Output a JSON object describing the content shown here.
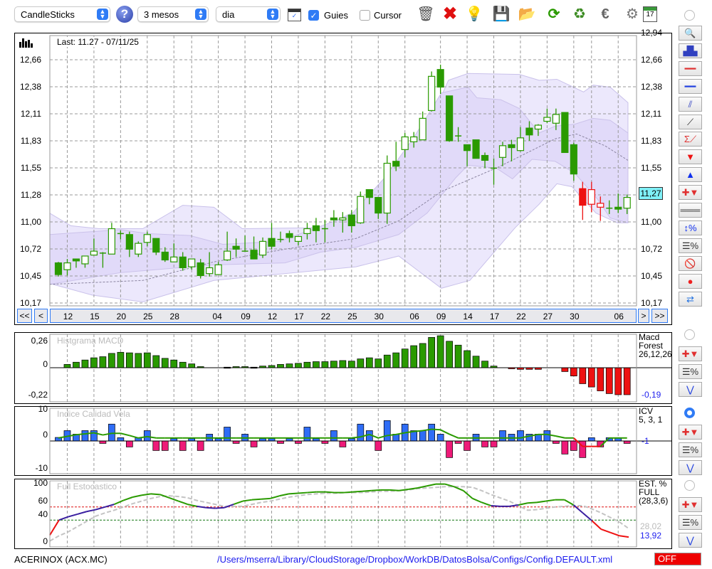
{
  "toolbar": {
    "chart_type": "CandleSticks",
    "period": "3 mesos",
    "interval": "dia",
    "guides_label": "Guies",
    "guides_checked": true,
    "cursor_label": "Cursor",
    "cursor_checked": false,
    "icons": [
      "help-icon",
      "chart-window-icon",
      "trash-icon",
      "delete-icon",
      "lamp-icon",
      "save-icon",
      "folder-icon",
      "refresh-icon",
      "recycle-icon",
      "euro-icon",
      "gear-icon",
      "calendar-icon"
    ],
    "calendar_day": "17"
  },
  "main": {
    "last_label": "Last: 11.27 - 07/11/25",
    "price_labels": [
      "12,94",
      "12,66",
      "12,38",
      "12,11",
      "11,83",
      "11,55",
      "11,28",
      "11,00",
      "10,72",
      "10,45",
      "10,17"
    ],
    "current_price": "11,27",
    "nav": {
      "first": "<<",
      "prev": "<",
      "next": ">",
      "last": ">>"
    },
    "date_labels": [
      {
        "t": "12",
        "i": 1
      },
      {
        "t": "15",
        "i": 4
      },
      {
        "t": "20",
        "i": 7
      },
      {
        "t": "25",
        "i": 10
      },
      {
        "t": "28",
        "i": 13
      },
      {
        "t": "04",
        "i": 17.8
      },
      {
        "t": "09",
        "i": 21
      },
      {
        "t": "12",
        "i": 24
      },
      {
        "t": "17",
        "i": 27
      },
      {
        "t": "22",
        "i": 30
      },
      {
        "t": "25",
        "i": 33
      },
      {
        "t": "30",
        "i": 36
      },
      {
        "t": "06",
        "i": 40
      },
      {
        "t": "09",
        "i": 43
      },
      {
        "t": "14",
        "i": 46
      },
      {
        "t": "17",
        "i": 49
      },
      {
        "t": "22",
        "i": 52
      },
      {
        "t": "27",
        "i": 55
      },
      {
        "t": "30",
        "i": 58
      },
      {
        "t": "06",
        "i": 63
      }
    ],
    "grid_index": [
      1,
      4,
      7,
      10,
      13,
      15,
      18,
      21,
      24,
      27,
      30,
      33,
      36,
      39,
      43,
      46,
      49,
      52,
      55,
      58,
      60,
      63
    ]
  },
  "chart_data": [
    {
      "type": "candlestick",
      "name": "ACERINOX price",
      "ylim": [
        10.17,
        12.94
      ],
      "up_color": "#ffffff",
      "down_color": "#2a9a00",
      "signal_color": "#ee1111",
      "candles": [
        [
          10.58,
          10.59,
          10.44,
          10.46
        ],
        [
          10.51,
          10.62,
          10.45,
          10.58
        ],
        [
          10.62,
          10.62,
          10.53,
          10.6
        ],
        [
          10.57,
          10.65,
          10.53,
          10.65
        ],
        [
          10.66,
          10.83,
          10.66,
          10.7
        ],
        [
          10.67,
          10.69,
          10.53,
          10.68
        ],
        [
          10.67,
          10.99,
          10.67,
          10.93
        ],
        [
          10.88,
          10.91,
          10.82,
          10.88
        ],
        [
          10.87,
          10.9,
          10.64,
          10.72
        ],
        [
          10.67,
          10.8,
          10.64,
          10.78
        ],
        [
          10.79,
          10.9,
          10.75,
          10.87
        ],
        [
          10.83,
          10.83,
          10.66,
          10.69
        ],
        [
          10.69,
          10.74,
          10.59,
          10.61
        ],
        [
          10.59,
          10.78,
          10.59,
          10.64
        ],
        [
          10.64,
          10.69,
          10.5,
          10.53
        ],
        [
          10.54,
          10.62,
          10.51,
          10.62
        ],
        [
          10.58,
          10.62,
          10.42,
          10.45
        ],
        [
          10.47,
          10.69,
          10.44,
          10.53
        ],
        [
          10.46,
          10.59,
          10.46,
          10.56
        ],
        [
          10.61,
          10.9,
          10.6,
          10.7
        ],
        [
          10.75,
          10.83,
          10.64,
          10.72
        ],
        [
          10.7,
          10.86,
          10.7,
          10.7
        ],
        [
          10.71,
          10.85,
          10.62,
          10.62
        ],
        [
          10.66,
          10.84,
          10.63,
          10.8
        ],
        [
          10.83,
          10.99,
          10.72,
          10.75
        ],
        [
          10.82,
          10.9,
          10.79,
          10.82
        ],
        [
          10.88,
          10.91,
          10.79,
          10.84
        ],
        [
          10.8,
          10.85,
          10.76,
          10.85
        ],
        [
          10.88,
          10.99,
          10.82,
          10.93
        ],
        [
          10.96,
          11.04,
          10.79,
          10.91
        ],
        [
          10.93,
          11.02,
          10.79,
          10.92
        ],
        [
          11.04,
          11.12,
          10.95,
          11.02
        ],
        [
          11.02,
          11.1,
          10.89,
          11.04
        ],
        [
          11.07,
          11.12,
          10.89,
          10.96
        ],
        [
          10.99,
          11.31,
          10.98,
          11.26
        ],
        [
          11.33,
          11.33,
          11.18,
          11.25
        ],
        [
          11.25,
          11.25,
          11.03,
          11.09
        ],
        [
          11.09,
          11.68,
          10.98,
          11.6
        ],
        [
          11.62,
          11.82,
          11.52,
          11.57
        ],
        [
          11.74,
          11.91,
          11.66,
          11.87
        ],
        [
          11.82,
          11.92,
          11.76,
          11.87
        ],
        [
          11.84,
          12.13,
          11.84,
          12.06
        ],
        [
          12.14,
          12.54,
          12.13,
          12.49
        ],
        [
          12.56,
          12.61,
          12.31,
          12.38
        ],
        [
          12.29,
          12.29,
          11.82,
          11.83
        ],
        [
          11.88,
          11.97,
          11.82,
          11.88
        ],
        [
          11.79,
          11.79,
          11.57,
          11.73
        ],
        [
          11.84,
          11.84,
          11.65,
          11.65
        ],
        [
          11.68,
          11.71,
          11.55,
          11.63
        ],
        [
          11.55,
          11.65,
          11.38,
          11.55
        ],
        [
          11.66,
          11.82,
          11.57,
          11.78
        ],
        [
          11.79,
          11.84,
          11.62,
          11.76
        ],
        [
          11.73,
          11.97,
          11.72,
          11.86
        ],
        [
          11.96,
          12.03,
          11.83,
          11.89
        ],
        [
          11.95,
          12.0,
          11.88,
          11.99
        ],
        [
          12.03,
          12.16,
          12.01,
          12.07
        ],
        [
          12.01,
          12.16,
          11.94,
          12.1
        ],
        [
          12.12,
          12.12,
          11.71,
          11.71
        ],
        [
          11.79,
          11.81,
          11.42,
          11.49
        ],
        [
          11.34,
          11.41,
          11.02,
          11.17
        ],
        [
          11.18,
          11.41,
          11.1,
          11.33
        ],
        [
          11.15,
          11.26,
          11.01,
          11.19
        ],
        [
          11.14,
          11.22,
          11.08,
          11.14
        ],
        [
          11.15,
          11.29,
          11.09,
          11.13
        ],
        [
          11.14,
          11.28,
          11.08,
          11.25
        ]
      ],
      "signal_candles": [
        59,
        60,
        61
      ],
      "bands": {
        "outer_upper": [
          [
            -1,
            11.09
          ],
          [
            1.4,
            10.96
          ],
          [
            4.6,
            10.93
          ],
          [
            9.5,
            10.93
          ],
          [
            14,
            11.17
          ],
          [
            17.5,
            11.15
          ],
          [
            20.7,
            10.93
          ],
          [
            29.5,
            10.94
          ],
          [
            33.5,
            11.11
          ],
          [
            38.3,
            11.6
          ],
          [
            41.5,
            11.96
          ],
          [
            43.9,
            12.45
          ],
          [
            46.1,
            12.52
          ],
          [
            51.9,
            12.51
          ],
          [
            54.1,
            12.45
          ],
          [
            56.1,
            12.46
          ],
          [
            59.1,
            12.33
          ],
          [
            60.2,
            12.4
          ],
          [
            62.1,
            12.38
          ],
          [
            64.1,
            12.22
          ]
        ],
        "inner_upper": [
          [
            -1,
            10.87
          ],
          [
            7,
            10.92
          ],
          [
            10,
            10.88
          ],
          [
            14.8,
            10.86
          ],
          [
            18.5,
            10.77
          ],
          [
            24.9,
            10.8
          ],
          [
            32.9,
            11.07
          ],
          [
            36.7,
            11.45
          ],
          [
            39.9,
            11.85
          ],
          [
            43.1,
            12.32
          ],
          [
            46.1,
            12.38
          ],
          [
            47.1,
            12.27
          ],
          [
            49.8,
            12.25
          ],
          [
            51.9,
            12.16
          ],
          [
            54.1,
            11.91
          ],
          [
            55.9,
            11.98
          ],
          [
            58.1,
            12.0
          ],
          [
            60.2,
            12.06
          ],
          [
            62.1,
            12.04
          ],
          [
            64.1,
            11.91
          ]
        ],
        "inner_lower": [
          [
            -1,
            10.36
          ],
          [
            7,
            10.48
          ],
          [
            17.5,
            10.56
          ],
          [
            25.5,
            10.58
          ],
          [
            29.5,
            10.69
          ],
          [
            33.5,
            10.74
          ],
          [
            38.3,
            10.87
          ],
          [
            41.5,
            11.09
          ],
          [
            44.7,
            11.45
          ],
          [
            46.1,
            11.58
          ],
          [
            49.3,
            11.55
          ],
          [
            51.1,
            11.44
          ],
          [
            53.3,
            11.64
          ],
          [
            55.9,
            11.62
          ],
          [
            58.1,
            11.5
          ],
          [
            60.7,
            11.23
          ],
          [
            62.1,
            11.04
          ],
          [
            64.1,
            10.99
          ]
        ],
        "outer_lower": [
          [
            -1,
            10.37
          ],
          [
            3.8,
            10.25
          ],
          [
            9.5,
            10.18
          ],
          [
            13.5,
            10.29
          ],
          [
            17.5,
            10.4
          ],
          [
            25.5,
            10.47
          ],
          [
            33.5,
            10.54
          ],
          [
            38.3,
            10.65
          ],
          [
            41.5,
            10.43
          ],
          [
            43.1,
            10.32
          ],
          [
            46.3,
            10.4
          ],
          [
            51.4,
            10.94
          ],
          [
            54.1,
            11.18
          ],
          [
            56.1,
            11.39
          ],
          [
            57.8,
            11.36
          ],
          [
            60.5,
            11.09
          ],
          [
            62.9,
            10.99
          ],
          [
            64.1,
            10.99
          ]
        ],
        "middle": [
          [
            -1,
            10.36
          ],
          [
            9.5,
            10.4
          ],
          [
            17.5,
            10.59
          ],
          [
            25.5,
            10.72
          ],
          [
            33.5,
            10.83
          ],
          [
            38.3,
            11.01
          ],
          [
            43.1,
            11.31
          ],
          [
            49.5,
            11.56
          ],
          [
            55.9,
            11.85
          ],
          [
            58.3,
            11.9
          ],
          [
            61.5,
            11.78
          ],
          [
            64.1,
            11.63
          ]
        ]
      }
    },
    {
      "type": "bar",
      "title": "Histgrama MACD",
      "y_labels": [
        "0,26",
        "0",
        "-0,22"
      ],
      "ylim": [
        -0.22,
        0.26
      ],
      "info": [
        "Macd",
        "Forest",
        "26,12,26"
      ],
      "last_value": "-0,19",
      "pos_color": "#2a9a00",
      "neg_color": "#ee1111",
      "values": [
        0,
        0.03,
        0.05,
        0.07,
        0.09,
        0.1,
        0.13,
        0.14,
        0.135,
        0.13,
        0.135,
        0.11,
        0.085,
        0.07,
        0.05,
        0.035,
        0.01,
        0,
        0,
        0.005,
        0.01,
        0.01,
        0.005,
        0.015,
        0.02,
        0.03,
        0.035,
        0.04,
        0.05,
        0.055,
        0.055,
        0.06,
        0.065,
        0.06,
        0.08,
        0.09,
        0.08,
        0.115,
        0.135,
        0.17,
        0.2,
        0.22,
        0.275,
        0.29,
        0.24,
        0.205,
        0.155,
        0.105,
        0.06,
        0.015,
        0,
        -0.005,
        -0.015,
        -0.015,
        -0.015,
        0,
        0,
        -0.035,
        -0.075,
        -0.145,
        -0.175,
        -0.21,
        -0.235,
        -0.245,
        -0.245
      ]
    },
    {
      "type": "bar",
      "title": "Indice Calidad Vela",
      "y_labels": [
        "10",
        "0",
        "-10"
      ],
      "ylim": [
        -10,
        10
      ],
      "info": [
        "ICV",
        "5, 3, 1"
      ],
      "last_value": "-1",
      "pos_color": "#2f6df6",
      "neg_color": "#ee1a78",
      "line_color": "#2a9a00",
      "line_neg_color": "#ee1111",
      "values": [
        1.3,
        3.8,
        2.5,
        3.8,
        3.8,
        -0.9,
        6.2,
        1.2,
        -2.2,
        1.2,
        3.8,
        -3.5,
        -3.5,
        0.9,
        -3.5,
        0.9,
        -3.5,
        2.5,
        0.9,
        5.1,
        -0.9,
        2.5,
        -2.2,
        0.9,
        0.9,
        -0.9,
        0.9,
        -0.9,
        5.1,
        0.9,
        -0.9,
        3.8,
        -2.2,
        0.9,
        6.2,
        3.8,
        -3.5,
        7.5,
        2.5,
        6.2,
        3.8,
        3.8,
        6.2,
        2.5,
        -6.1,
        -0.9,
        -3.5,
        2.5,
        -2.2,
        -2.2,
        3.8,
        2.5,
        3.8,
        2.5,
        2.5,
        3.8,
        -0.9,
        -4.8,
        -3.5,
        -6.1,
        1.2,
        -2.2,
        1.2,
        1.2,
        -0.9
      ],
      "line": [
        1.1,
        1.7,
        2.3,
        2.6,
        3.0,
        2.2,
        2.8,
        2.8,
        2.0,
        1.1,
        1.6,
        1.1,
        1.1,
        1.1,
        1.1,
        1.1,
        1.1,
        1.1,
        1.1,
        1.1,
        1.1,
        1.1,
        1.1,
        1.1,
        1.1,
        1.1,
        1.1,
        1.1,
        1.1,
        1.1,
        1.1,
        1.1,
        1.1,
        1.1,
        1.5,
        2.4,
        1.1,
        2.0,
        2.4,
        3.0,
        3.5,
        3.8,
        4.3,
        4.1,
        2.5,
        1.1,
        1.1,
        1.1,
        1.1,
        1.1,
        1.1,
        1.1,
        1.1,
        1.8,
        2.4,
        2.4,
        1.8,
        1.1,
        1.1,
        -2.0,
        -2.0,
        -2.0,
        1.1,
        1.1,
        1.1
      ]
    },
    {
      "type": "line",
      "title": "Full Estocastico",
      "y_labels": [
        "100",
        "60",
        "40",
        "0"
      ],
      "ylim": [
        0,
        100
      ],
      "levels": [
        60,
        40
      ],
      "info": [
        "EST. %",
        "FULL",
        "(28,3,6)"
      ],
      "d_value": "28,02",
      "k_value": "13,92",
      "k": [
        17,
        40,
        45,
        49,
        53,
        56,
        60,
        64,
        70,
        75,
        78,
        80,
        79,
        74,
        69,
        64,
        61,
        59,
        58,
        59,
        64,
        69,
        71,
        72,
        73,
        77,
        80,
        81,
        82,
        83,
        83,
        82,
        82,
        83,
        84,
        85,
        86,
        86,
        85,
        87,
        89,
        92,
        95,
        95,
        91,
        85,
        73,
        67,
        62,
        61,
        61,
        63,
        66,
        67,
        69,
        71,
        71,
        63,
        51,
        39,
        26,
        21,
        16,
        14
      ],
      "d": [
        8,
        16,
        22,
        30,
        38,
        46,
        51,
        55,
        60,
        65,
        69,
        73,
        76,
        77,
        76,
        74,
        70,
        67,
        64,
        61,
        61,
        61,
        64,
        67,
        69,
        72,
        75,
        77,
        79,
        80,
        81,
        81,
        82,
        82,
        82,
        83,
        84,
        84,
        85,
        86,
        88,
        89,
        90,
        91,
        91,
        91,
        90,
        85,
        79,
        74,
        69,
        62,
        55,
        56,
        58,
        60,
        61,
        62,
        62,
        57,
        51,
        44,
        37,
        27
      ]
    }
  ],
  "footer": {
    "symbol": "ACERINOX (ACX.MC)",
    "config_path": "/Users/mserra/Library/CloudStorage/Dropbox/WorkDB/DatosBolsa/Configs/Config.DEFAULT.xml",
    "status": "OFF"
  },
  "sidebar": {
    "main_tools": [
      "zoom",
      "chart-overlay",
      "horizontal-line-red",
      "horizontal-line-blue",
      "channel",
      "trend-line",
      "fibonacci",
      "sell-signal",
      "buy-signal",
      "signals",
      "dashed-lines",
      "percent-range",
      "percent-lines",
      "no-entry",
      "record",
      "refresh"
    ],
    "panel_tools": [
      "signals",
      "percent-lines",
      "curve"
    ]
  }
}
